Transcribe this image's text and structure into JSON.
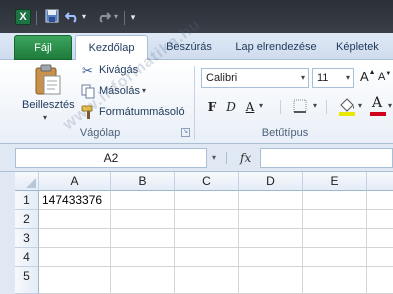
{
  "title_bar": {
    "app_icon_label": "X",
    "icons": [
      "excel-icon",
      "save-icon",
      "undo-icon",
      "undo-dropdown-icon",
      "redo-icon",
      "redo-dropdown-icon",
      "customize-qat-icon"
    ]
  },
  "tabs": [
    {
      "label": "Fájl"
    },
    {
      "label": "Kezdőlap"
    },
    {
      "label": "Beszúrás"
    },
    {
      "label": "Lap elrendezése"
    },
    {
      "label": "Képletek"
    }
  ],
  "ribbon": {
    "clipboard": {
      "paste_label": "Beillesztés",
      "cut_label": "Kivágás",
      "copy_label": "Másolás",
      "format_painter_label": "Formátummásoló",
      "group_label": "Vágólap"
    },
    "font": {
      "font_name": "Calibri",
      "font_size": "11",
      "bold": "F",
      "italic": "D",
      "underline": "A",
      "grow": "A",
      "shrink": "A",
      "font_color": "A",
      "group_label": "Betűtípus"
    }
  },
  "formula_bar": {
    "name_box": "A2",
    "fx_label": "fx",
    "formula_value": ""
  },
  "sheet": {
    "columns": [
      "A",
      "B",
      "C",
      "D",
      "E"
    ],
    "rows": [
      "1",
      "2",
      "3",
      "4",
      "5"
    ],
    "cells": {
      "A1": "147433376"
    }
  },
  "colors": {
    "file_tab": "#2e8f4c",
    "excel_green": "#1f7244",
    "underline_color": "#e8e800",
    "font_color_red": "#d0021b"
  },
  "watermark": "www.informatika.hu"
}
